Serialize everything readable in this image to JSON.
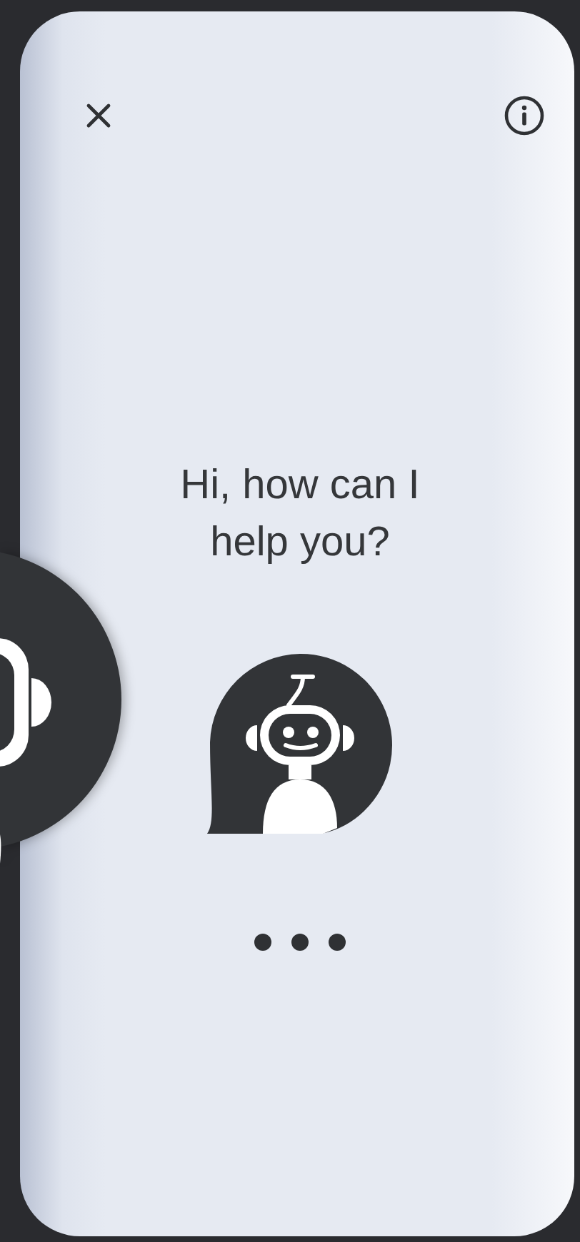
{
  "greeting": "Hi, how can I help you?",
  "typing_indicator": true
}
